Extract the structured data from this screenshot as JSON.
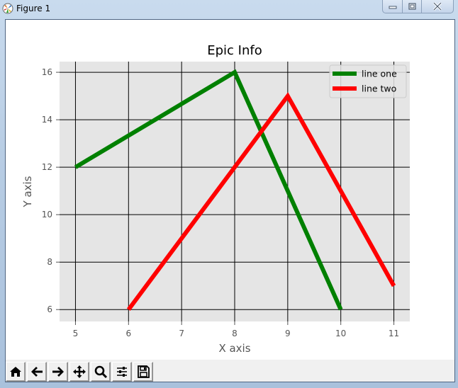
{
  "window": {
    "title": "Figure 1",
    "controls": [
      {
        "name": "minimize",
        "icon": "minimize-icon"
      },
      {
        "name": "maximize",
        "icon": "maximize-icon"
      },
      {
        "name": "close",
        "icon": "close-icon"
      }
    ]
  },
  "toolbar": {
    "buttons": [
      {
        "name": "home",
        "icon": "home-icon",
        "label": "Home"
      },
      {
        "name": "back",
        "icon": "arrow-left-icon",
        "label": "Back"
      },
      {
        "name": "forward",
        "icon": "arrow-right-icon",
        "label": "Forward"
      },
      {
        "name": "pan",
        "icon": "move-icon",
        "label": "Pan"
      },
      {
        "name": "zoom",
        "icon": "magnifier-icon",
        "label": "Zoom"
      },
      {
        "name": "configure",
        "icon": "sliders-icon",
        "label": "Configure subplots"
      },
      {
        "name": "save",
        "icon": "save-icon",
        "label": "Save"
      }
    ]
  },
  "chart_data": {
    "type": "line",
    "title": "Epic Info",
    "xlabel": "X axis",
    "ylabel": "Y axis",
    "xlim": [
      4.7,
      11.3
    ],
    "ylim": [
      5.5,
      16.45
    ],
    "xticks": [
      5,
      6,
      7,
      8,
      9,
      10,
      11
    ],
    "yticks": [
      6,
      8,
      10,
      12,
      14,
      16
    ],
    "grid": true,
    "legend_position": "top-right",
    "background": "#e5e5e5",
    "series": [
      {
        "name": "line one",
        "color": "#008000",
        "x": [
          5,
          8,
          10
        ],
        "y": [
          12,
          16,
          6
        ]
      },
      {
        "name": "line two",
        "color": "#ff0000",
        "x": [
          6,
          9,
          11
        ],
        "y": [
          6,
          15,
          7
        ]
      }
    ]
  }
}
